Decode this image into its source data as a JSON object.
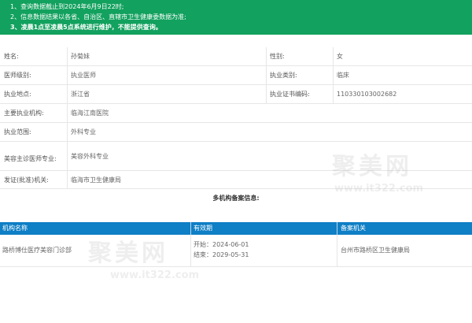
{
  "notice": {
    "line1": "1、查询数据截止到2024年6月9日22时;",
    "line2": "2、信息数据结果以各省、自治区、直辖市卫生健康委数据为准;",
    "line3": "3、凌晨1点至凌晨5点系统进行维护，不能提供查询。"
  },
  "info": {
    "name_label": "姓名:",
    "name_value": "孙菊妹",
    "gender_label": "性别:",
    "gender_value": "女",
    "level_label": "医师级别:",
    "level_value": "执业医师",
    "category_label": "执业类别:",
    "category_value": "临床",
    "location_label": "执业地点:",
    "location_value": "浙江省",
    "cert_label": "执业证书编码:",
    "cert_value": "110330103002682",
    "institution_label": "主要执业机构:",
    "institution_value": "临海江南医院",
    "scope_label": "执业范围:",
    "scope_value": "外科专业",
    "cosmetic_label": "美容主诊医师专业:",
    "cosmetic_value": "美容外科专业",
    "authority_label": "发证(批准)机关:",
    "authority_value": "临海市卫生健康局"
  },
  "multi": {
    "title": "多机构备案信息:",
    "headers": {
      "institution": "机构名称",
      "validity": "有效期",
      "authority": "备案机关"
    },
    "rows": [
      {
        "institution": "路桥博仕医疗美容门诊部",
        "start": "开始：2024-06-01",
        "end": "结束：2029-05-31",
        "authority": "台州市路桥区卫生健康局"
      }
    ]
  },
  "watermark": {
    "brand": "聚美网",
    "url": "www.it322.com"
  }
}
